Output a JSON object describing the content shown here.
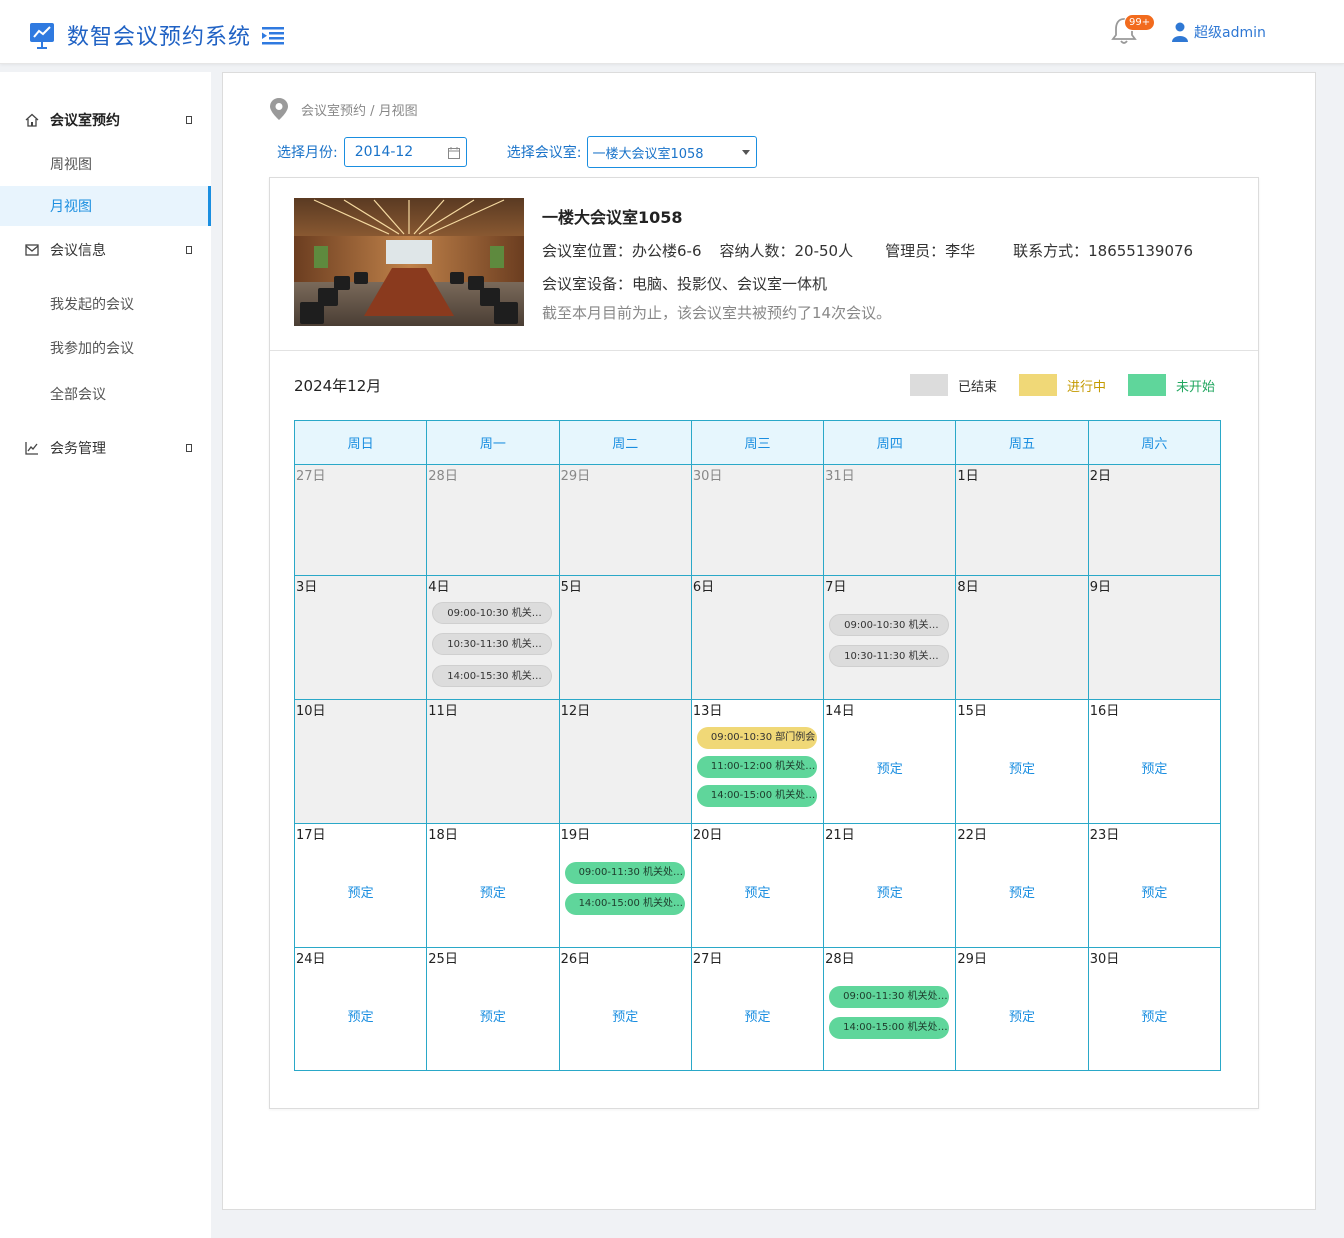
{
  "header": {
    "title": "数智会议预约系统",
    "notification_badge": "99+",
    "user_name": "超级admin",
    "icons": [
      "chart-logo-icon",
      "menu-fold-icon",
      "bell-icon",
      "user-icon"
    ]
  },
  "sidebar": {
    "groups": [
      {
        "label": "会议室预约",
        "icon": "home-icon",
        "items": [
          "周视图",
          "月视图"
        ]
      },
      {
        "label": "会议信息",
        "icon": "mail-icon",
        "items": [
          "我发起的会议",
          "我参加的会议",
          "全部会议"
        ]
      },
      {
        "label": "会务管理",
        "icon": "line-chart-icon",
        "items": []
      }
    ],
    "active_item": "月视图"
  },
  "breadcrumb": "会议室预约 / 月视图",
  "filters": {
    "month_label": "选择月份:",
    "month_value": "2014-12",
    "room_label": "选择会议室:",
    "room_value": "一楼大会议室1058"
  },
  "room": {
    "name": "一楼大会议室1058",
    "location": "会议室位置：办公楼6-6",
    "capacity": "容纳人数：20-50人",
    "manager": "管理员：李华",
    "contact": "联系方式：18655139076",
    "equipment": "会议室设备：电脑、投影仪、会议室一体机",
    "note": "截至本月目前为止，该会议室共被预约了14次会议。"
  },
  "calendar": {
    "month_title": "2024年12月",
    "legend": [
      {
        "label": "已结束",
        "color": "#dcdcdc"
      },
      {
        "label": "进行中",
        "color": "#f0d877"
      },
      {
        "label": "未开始",
        "color": "#5fd69b"
      }
    ],
    "weekdays": [
      "周日",
      "周一",
      "周二",
      "周三",
      "周四",
      "周五",
      "周六"
    ],
    "book_label": "预定",
    "weeks": [
      {
        "days": [
          {
            "day": "27日",
            "other": true,
            "state": "past"
          },
          {
            "day": "28日",
            "other": true,
            "state": "past"
          },
          {
            "day": "29日",
            "other": true,
            "state": "past"
          },
          {
            "day": "30日",
            "other": true,
            "state": "past"
          },
          {
            "day": "31日",
            "other": true,
            "state": "past"
          },
          {
            "day": "1日",
            "state": "past"
          },
          {
            "day": "2日",
            "state": "past"
          }
        ]
      },
      {
        "days": [
          {
            "day": "3日",
            "state": "past"
          },
          {
            "day": "4日",
            "state": "past",
            "events": [
              {
                "text": "09:00-10:30 机关处级...",
                "status": "ended"
              },
              {
                "text": "10:30-11:30 机关处级...",
                "status": "ended"
              },
              {
                "text": "14:00-15:30 机关处级...",
                "status": "ended"
              }
            ]
          },
          {
            "day": "5日",
            "state": "past"
          },
          {
            "day": "6日",
            "state": "past"
          },
          {
            "day": "7日",
            "state": "past",
            "events": [
              {
                "text": "09:00-10:30 机关处级...",
                "status": "ended"
              },
              {
                "text": "10:30-11:30 机关处级...",
                "status": "ended"
              }
            ]
          },
          {
            "day": "8日",
            "state": "past"
          },
          {
            "day": "9日",
            "state": "past"
          }
        ]
      },
      {
        "days": [
          {
            "day": "10日",
            "state": "past"
          },
          {
            "day": "11日",
            "state": "past"
          },
          {
            "day": "12日",
            "state": "past"
          },
          {
            "day": "13日",
            "state": "future",
            "events": [
              {
                "text": "09:00-10:30 部门例会",
                "status": "ongoing"
              },
              {
                "text": "11:00-12:00 机关处级...",
                "status": "upcoming"
              },
              {
                "text": "14:00-15:00 机关处级...",
                "status": "upcoming"
              }
            ]
          },
          {
            "day": "14日",
            "state": "future",
            "book": true
          },
          {
            "day": "15日",
            "state": "future",
            "book": true
          },
          {
            "day": "16日",
            "state": "future",
            "book": true
          }
        ]
      },
      {
        "days": [
          {
            "day": "17日",
            "state": "future",
            "book": true
          },
          {
            "day": "18日",
            "state": "future",
            "book": true
          },
          {
            "day": "19日",
            "state": "future",
            "events": [
              {
                "text": "09:00-11:30 机关处级...",
                "status": "upcoming"
              },
              {
                "text": "14:00-15:00 机关处级...",
                "status": "upcoming"
              }
            ]
          },
          {
            "day": "20日",
            "state": "future",
            "book": true
          },
          {
            "day": "21日",
            "state": "future",
            "book": true
          },
          {
            "day": "22日",
            "state": "future",
            "book": true
          },
          {
            "day": "23日",
            "state": "future",
            "book": true
          }
        ]
      },
      {
        "days": [
          {
            "day": "24日",
            "state": "future",
            "book": true
          },
          {
            "day": "25日",
            "state": "future",
            "book": true
          },
          {
            "day": "26日",
            "state": "future",
            "book": true
          },
          {
            "day": "27日",
            "state": "future",
            "book": true
          },
          {
            "day": "28日",
            "state": "future",
            "events": [
              {
                "text": "09:00-11:30 机关处级...",
                "status": "upcoming"
              },
              {
                "text": "14:00-15:00 机关处级...",
                "status": "upcoming"
              }
            ]
          },
          {
            "day": "29日",
            "state": "future",
            "book": true
          },
          {
            "day": "30日",
            "state": "future",
            "book": true
          }
        ]
      }
    ]
  }
}
